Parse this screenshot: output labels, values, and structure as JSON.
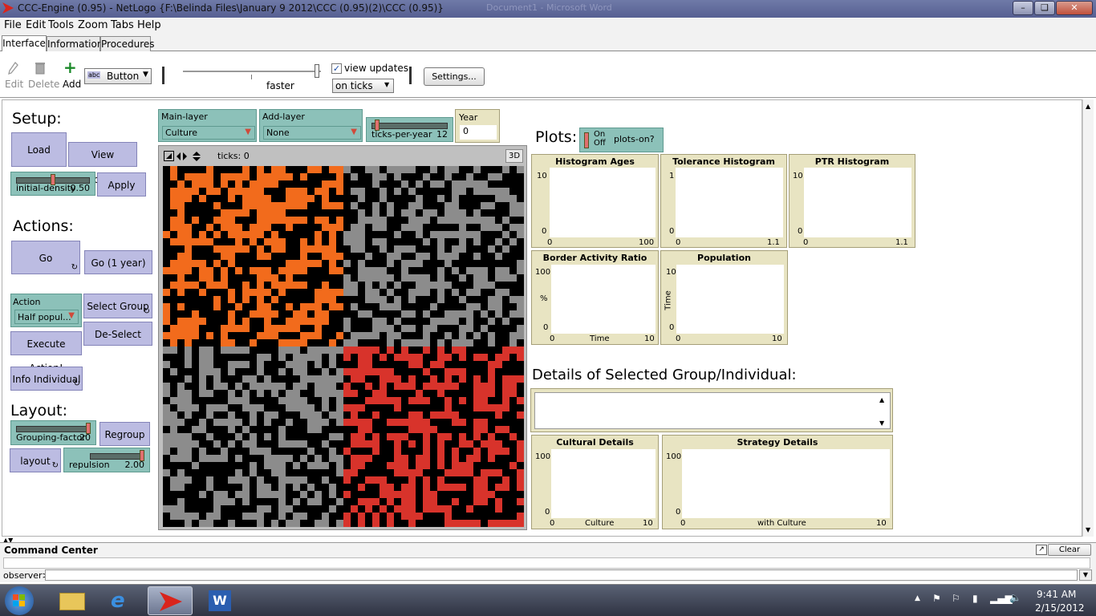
{
  "window": {
    "title": "CCC-Engine (0.95) - NetLogo {F:\\Belinda Files\\January 9 2012\\CCC (0.95)(2)\\CCC (0.95)}",
    "ghost_title": "Document1 - Microsoft Word"
  },
  "menu": [
    "File",
    "Edit",
    "Tools",
    "Zoom",
    "Tabs",
    "Help"
  ],
  "tabs": [
    "Interface",
    "Information",
    "Procedures"
  ],
  "toolbar": {
    "edit": "Edit",
    "delete": "Delete",
    "add": "Add",
    "widget_type": "Button",
    "widget_type_icon": "abc",
    "speed_label": "faster",
    "speed_fraction": 0.99,
    "view_updates_label": "view updates",
    "view_updates_checked": true,
    "update_mode": "on ticks",
    "settings": "Settings..."
  },
  "setup": {
    "header": "Setup:",
    "load": "Load",
    "view_description": "View Description",
    "initial_density": {
      "label": "initial-density",
      "value": "0.50",
      "fraction": 0.5
    },
    "apply": "Apply"
  },
  "actions": {
    "header": "Actions:",
    "go": "Go",
    "go_year": "Go (1 year)",
    "action_label": "Action",
    "action_value": "Half popul...",
    "select_group": "Select Group",
    "de_select": "De-Select",
    "execute": "Execute Action!",
    "info_individual": "Info Individual"
  },
  "layout": {
    "header": "Layout:",
    "grouping_factor": {
      "label": "Grouping-factor",
      "value": "20",
      "fraction": 1.0
    },
    "regroup": "Regroup",
    "layout_btn": "layout",
    "repulsion": {
      "label": "repulsion",
      "value": "2.00",
      "fraction": 1.0
    }
  },
  "choosers": {
    "main_layer": {
      "label": "Main-layer",
      "value": "Culture"
    },
    "add_layer": {
      "label": "Add-layer",
      "value": "None"
    },
    "ticks_per_year": {
      "label": "ticks-per-year",
      "value": "12",
      "fraction": 0.05
    },
    "year": {
      "label": "Year",
      "value": "0"
    }
  },
  "view": {
    "ticks_label": "ticks: 0",
    "three_d": "3D"
  },
  "plots_header": "Plots:",
  "plots_switch": {
    "state_on": "On",
    "state_off": "Off",
    "label": "plots-on?"
  },
  "plots": [
    {
      "title": "Histogram Ages",
      "ymax": "10",
      "ymin": "0",
      "xmin": "0",
      "xmax": "100",
      "xlabel": "",
      "ylabel": ""
    },
    {
      "title": "Tolerance Histogram",
      "ymax": "1",
      "ymin": "0",
      "xmin": "0",
      "xmax": "1.1",
      "xlabel": "",
      "ylabel": ""
    },
    {
      "title": "PTR Histogram",
      "ymax": "10",
      "ymin": "0",
      "xmin": "0",
      "xmax": "1.1",
      "xlabel": "",
      "ylabel": ""
    },
    {
      "title": "Border Activity Ratio",
      "ymax": "100",
      "ymin": "0",
      "xmin": "0",
      "xmax": "10",
      "xlabel": "Time",
      "ylabel": "%"
    },
    {
      "title": "Population",
      "ymax": "10",
      "ymin": "0",
      "xmin": "0",
      "xmax": "10",
      "xlabel": "",
      "ylabel": "Time"
    },
    {
      "title": "Cultural Details",
      "ymax": "100",
      "ymin": "0",
      "xmin": "0",
      "xmax": "10",
      "xlabel": "Culture",
      "ylabel": ""
    },
    {
      "title": "Strategy Details",
      "ymax": "100",
      "ymin": "0",
      "xmin": "0",
      "xmax": "10",
      "xlabel": "with Culture",
      "ylabel": ""
    }
  ],
  "details_header": "Details of Selected Group/Individual:",
  "details_text": "",
  "command_center": {
    "title": "Command Center",
    "clear": "Clear",
    "prompt": "observer>",
    "input": ""
  },
  "colors": {
    "orange": "#f26b1c",
    "red": "#d8332b",
    "gray": "#8c8c8c",
    "black": "#000000",
    "button": "#bcbce2",
    "slider": "#8cc1b9",
    "monitor": "#e8e4c2"
  },
  "taskbar": {
    "start_icon": "windows-start-icon",
    "apps": [
      "folder-icon",
      "internet-explorer-icon",
      "netlogo-icon",
      "word-icon"
    ],
    "time": "9:41 AM",
    "date": "2/15/2012"
  }
}
